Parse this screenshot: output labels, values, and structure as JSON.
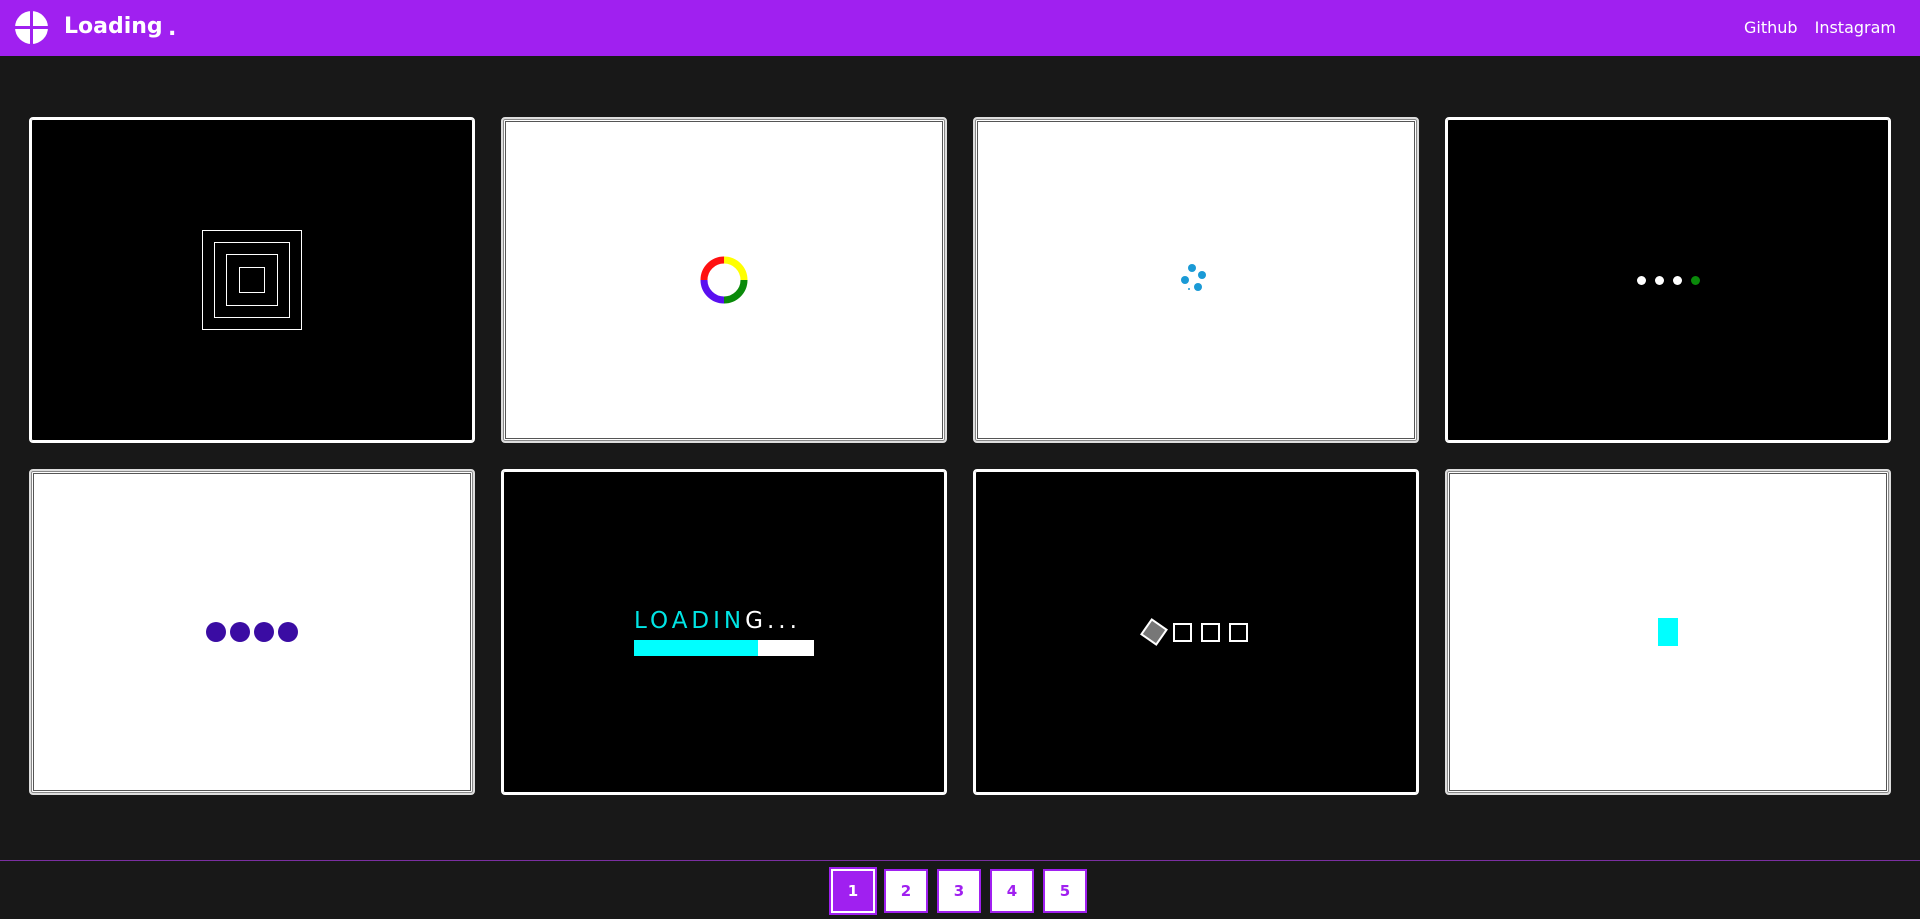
{
  "navbar": {
    "brand": "Loading",
    "brand_dot": ".",
    "logo_icon": "crosshair-circle-icon",
    "links": [
      "Github",
      "Instagram"
    ]
  },
  "cards": [
    {
      "theme": "dark",
      "loader": "nested-squares-icon"
    },
    {
      "theme": "light",
      "loader": "rainbow-ring-icon"
    },
    {
      "theme": "light",
      "loader": "blue-dot-spinner-icon"
    },
    {
      "theme": "dark",
      "loader": "dots-green-icon"
    },
    {
      "theme": "light",
      "loader": "purple-circles-icon"
    },
    {
      "theme": "dark",
      "loader": "loading-bar",
      "text_cyan": "LOADIN",
      "text_white": "G...",
      "progress": 0.69
    },
    {
      "theme": "dark",
      "loader": "rotating-squares-icon"
    },
    {
      "theme": "light",
      "loader": "cyan-block-icon"
    }
  ],
  "colors": {
    "nav_bg": "#a020f0",
    "page_bg": "#181818",
    "accent_cyan": "#00ffff",
    "accent_purple": "#3a0ca3"
  },
  "pagination": {
    "pages": [
      "1",
      "2",
      "3",
      "4",
      "5"
    ],
    "active": "1"
  }
}
